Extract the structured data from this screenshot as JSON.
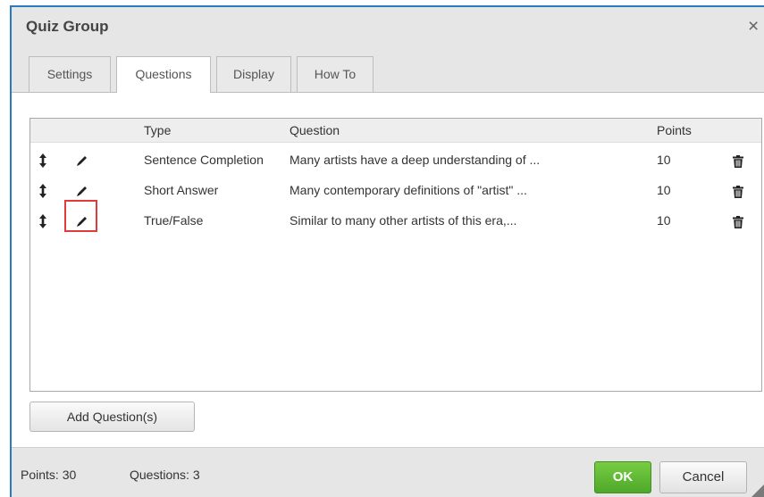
{
  "dialog": {
    "title": "Quiz Group",
    "close_icon": "×"
  },
  "tabs": [
    {
      "label": "Settings",
      "active": false
    },
    {
      "label": "Questions",
      "active": true
    },
    {
      "label": "Display",
      "active": false
    },
    {
      "label": "How To",
      "active": false
    }
  ],
  "grid": {
    "columns": {
      "type": "Type",
      "question": "Question",
      "points": "Points"
    },
    "rows": [
      {
        "type": "Sentence Completion",
        "question": "Many artists have a deep understanding of ...",
        "points": "10"
      },
      {
        "type": "Short Answer",
        "question": "Many contemporary definitions of \"artist\" ...",
        "points": "10"
      },
      {
        "type": "True/False",
        "question": "Similar to many other artists of this era,...",
        "points": "10"
      }
    ],
    "icons": {
      "drag": "drag-handle-icon",
      "edit": "pencil-icon",
      "delete": "trash-icon"
    },
    "highlighted_row": 2
  },
  "add_button": {
    "label": "Add Question(s)"
  },
  "footer": {
    "points_text": "Points: 30",
    "questions_text": "Questions: 3"
  },
  "buttons": {
    "ok": "OK",
    "cancel": "Cancel"
  },
  "colors": {
    "ok_green": "#5cb832",
    "highlight_red": "#e03a3a",
    "frame_blue": "#2b79c2"
  }
}
